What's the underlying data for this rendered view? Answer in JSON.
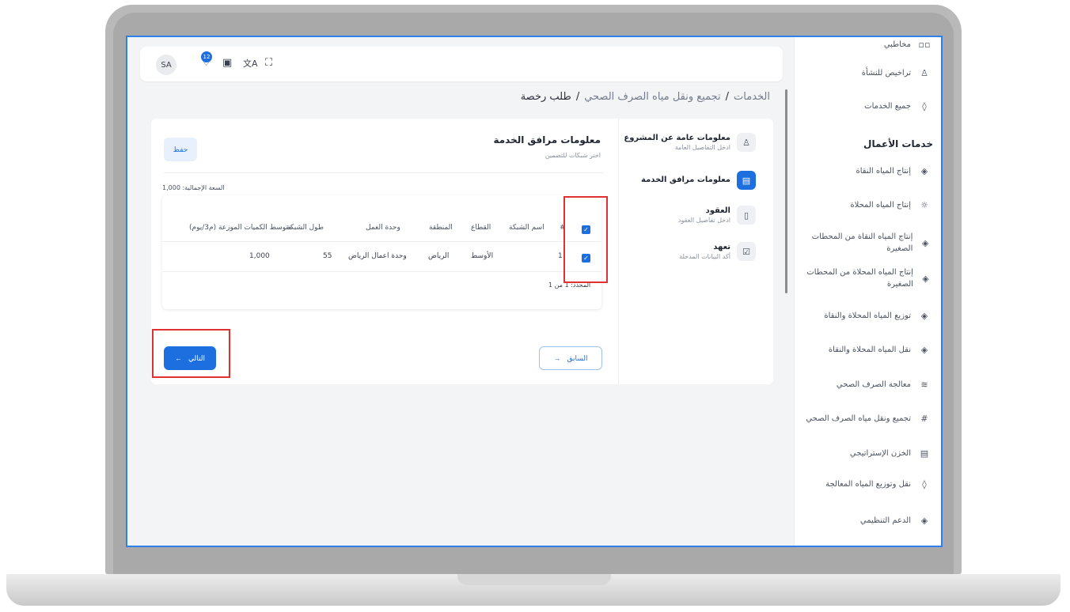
{
  "topbar": {
    "avatar": "SA",
    "notification_count": "12",
    "icons": [
      "bell-icon",
      "clipboard-check-icon",
      "translate-icon",
      "fullscreen-icon"
    ]
  },
  "breadcrumb": {
    "items": [
      "الخدمات",
      "تجميع ونقل مياه الصرف الصحي",
      "طلب رخصة"
    ],
    "separator": "/"
  },
  "sidebar": {
    "heading": "خدمات الأعمال",
    "top_items": [
      {
        "label": "مخاطبي",
        "icon": "grid-icon"
      },
      {
        "label": "تراخيص للنشأة",
        "icon": "user-icon"
      },
      {
        "label": "جميع الخدمات",
        "icon": "drop-icon"
      }
    ],
    "items": [
      {
        "label": "إنتاج المياه النقاة",
        "icon": "drop-icon"
      },
      {
        "label": "إنتاج المياه المحلاة",
        "icon": "sun-icon"
      },
      {
        "label": "إنتاج المياه النقاة من المحطات الصغيرة",
        "icon": "drop-icon"
      },
      {
        "label": "إنتاج المياه المحلاة من المحطات الصغيرة",
        "icon": "drop-icon"
      },
      {
        "label": "توزيع المياه المحلاة والنقاة",
        "icon": "drop-icon"
      },
      {
        "label": "نقل المياه المحلاة والنقاة",
        "icon": "drop-icon"
      },
      {
        "label": "معالجة الصرف الصحي",
        "icon": "waves-icon"
      },
      {
        "label": "تجميع ونقل مياه الصرف الصحي",
        "icon": "grid-hash-icon"
      },
      {
        "label": "الخزن الإستراتيجي",
        "icon": "storage-icon"
      },
      {
        "label": "نقل وتوزيع المياه المعالجة",
        "icon": "drop-icon"
      },
      {
        "label": "الدعم التنظيمي",
        "icon": "drop-icon"
      }
    ]
  },
  "steps": [
    {
      "title": "معلومات عامة عن المشروع",
      "subtitle": "ادخل التفاصيل العامة",
      "icon": "user-icon",
      "active": false
    },
    {
      "title": "معلومات مرافق الخدمة",
      "subtitle": "",
      "icon": "id-card-icon",
      "active": true
    },
    {
      "title": "العقود",
      "subtitle": "ادخل تفاصيل العقود",
      "icon": "document-icon",
      "active": false
    },
    {
      "title": "تعهد",
      "subtitle": "أكد البيانات المدخلة",
      "icon": "check-square-icon",
      "active": false
    }
  ],
  "section": {
    "title": "معلومات مرافق الخدمة",
    "subtitle": "اختر شبكات للتضمين",
    "save_label": "حفظ",
    "capacity_label": "السعة الإجمالية: 1,000"
  },
  "table": {
    "headers": [
      "#",
      "اسم الشبكة",
      "القطاع",
      "المنطقة",
      "وحدة العمل",
      "طول الشبكة",
      "متوسط الكميات الموزعة (م3/يوم)"
    ],
    "rows": [
      {
        "index": "1",
        "network_name": "",
        "sector": "الأوسط",
        "region": "الرياض",
        "work_unit": "وحدة اعمال الرياض",
        "length": "55",
        "avg_quantity": "1,000",
        "checked": true
      }
    ],
    "pager": "المحدد: 1 من 1"
  },
  "buttons": {
    "prev_label": "السابق",
    "next_label": "التالي"
  },
  "colors": {
    "accent": "#1d6fe0",
    "highlight": "#e03131",
    "screen_border": "#2f80ed"
  }
}
